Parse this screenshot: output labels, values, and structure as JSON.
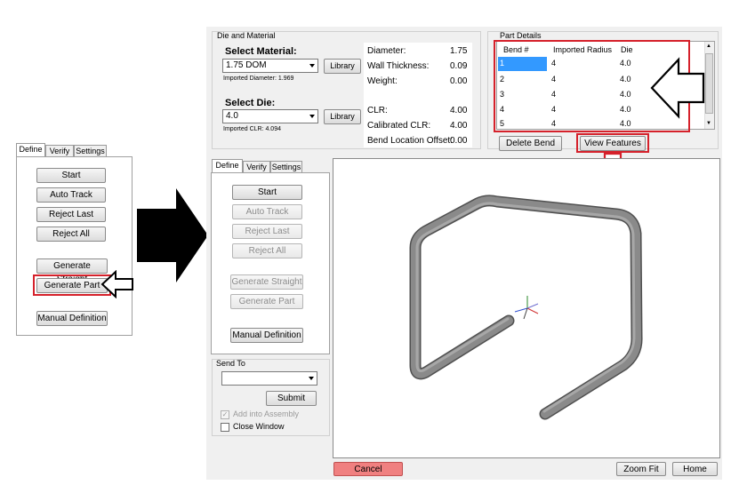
{
  "small_panel": {
    "tabs": [
      "Define",
      "Verify",
      "Settings"
    ],
    "buttons": [
      "Start",
      "Auto Track",
      "Reject Last",
      "Reject All",
      "Generate Straight",
      "Generate Part",
      "Manual Definition"
    ]
  },
  "die_material": {
    "group_title": "Die and Material",
    "select_material_label": "Select Material:",
    "material_value": "1.75 DOM",
    "library_label": "Library",
    "imported_diameter": "Imported Diameter: 1.969",
    "select_die_label": "Select Die:",
    "die_value": "4.0",
    "imported_clr": "Imported CLR: 4.094",
    "props": [
      {
        "label": "Diameter:",
        "value": "1.75"
      },
      {
        "label": "Wall Thickness:",
        "value": "0.09"
      },
      {
        "label": "Weight:",
        "value": "0.00"
      },
      {
        "label": "CLR:",
        "value": "4.00"
      },
      {
        "label": "Calibrated CLR:",
        "value": "4.00"
      },
      {
        "label": "Bend Location Offset:",
        "value": "0.00"
      }
    ]
  },
  "part_details": {
    "group_title": "Part Details",
    "columns": [
      "Bend #",
      "Imported Radius",
      "Die"
    ],
    "rows": [
      [
        "1",
        "4",
        "4.0"
      ],
      [
        "2",
        "4",
        "4.0"
      ],
      [
        "3",
        "4",
        "4.0"
      ],
      [
        "4",
        "4",
        "4.0"
      ],
      [
        "5",
        "4",
        "4.0"
      ]
    ],
    "delete_bend_label": "Delete Bend",
    "view_features_label": "View Features"
  },
  "main_panel": {
    "tabs": [
      "Define",
      "Verify",
      "Settings"
    ],
    "buttons": [
      "Start",
      "Auto Track",
      "Reject Last",
      "Reject All",
      "Generate Straight",
      "Generate Part",
      "Manual Definition"
    ]
  },
  "send_to": {
    "group_title": "Send To",
    "submit_label": "Submit",
    "add_assembly_label": "Add into Assembly",
    "close_window_label": "Close Window"
  },
  "bottom": {
    "cancel_label": "Cancel",
    "zoom_fit_label": "Zoom Fit",
    "home_label": "Home"
  },
  "colors": {
    "highlight_red": "#d5212b",
    "selection_blue": "#3399ff",
    "cancel_fill": "#f08080",
    "tube_gray": "#8a8a8a"
  }
}
